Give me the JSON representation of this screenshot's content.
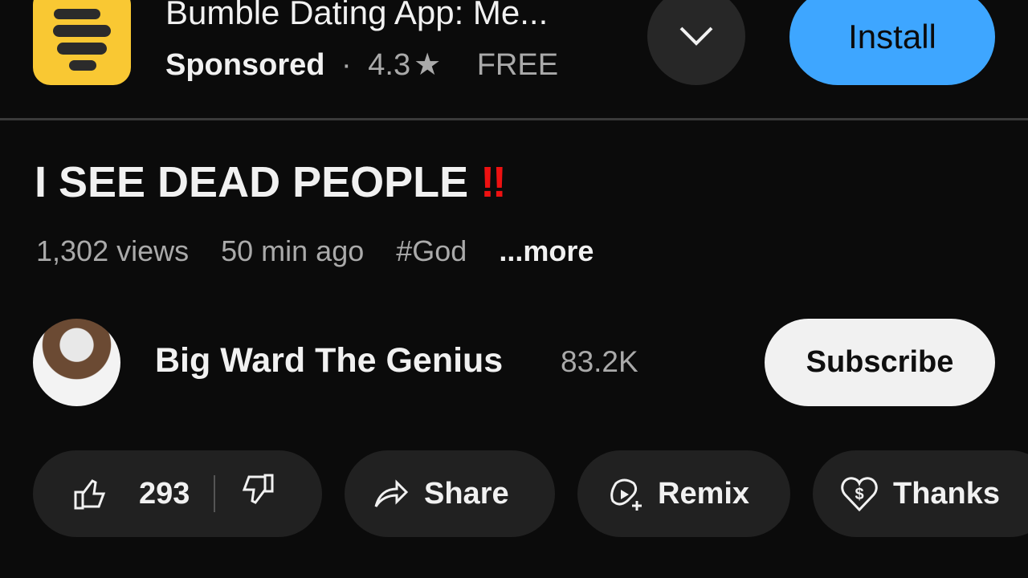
{
  "ad": {
    "title": "Bumble Dating App: Me...",
    "sponsored": "Sponsored",
    "separator": "·",
    "rating": "4.3",
    "price": "FREE",
    "install_label": "Install",
    "brand_color": "#f9c833",
    "install_color": "#3ea6ff"
  },
  "video": {
    "title": "I SEE DEAD PEOPLE",
    "title_emoji": "‼",
    "views": "1,302 views",
    "age": "50 min ago",
    "hashtag": "#God",
    "more": "...more"
  },
  "channel": {
    "name": "Big Ward The Genius",
    "subscribers": "83.2K",
    "subscribe_label": "Subscribe"
  },
  "actions": {
    "likes": "293",
    "share": "Share",
    "remix": "Remix",
    "thanks": "Thanks"
  }
}
